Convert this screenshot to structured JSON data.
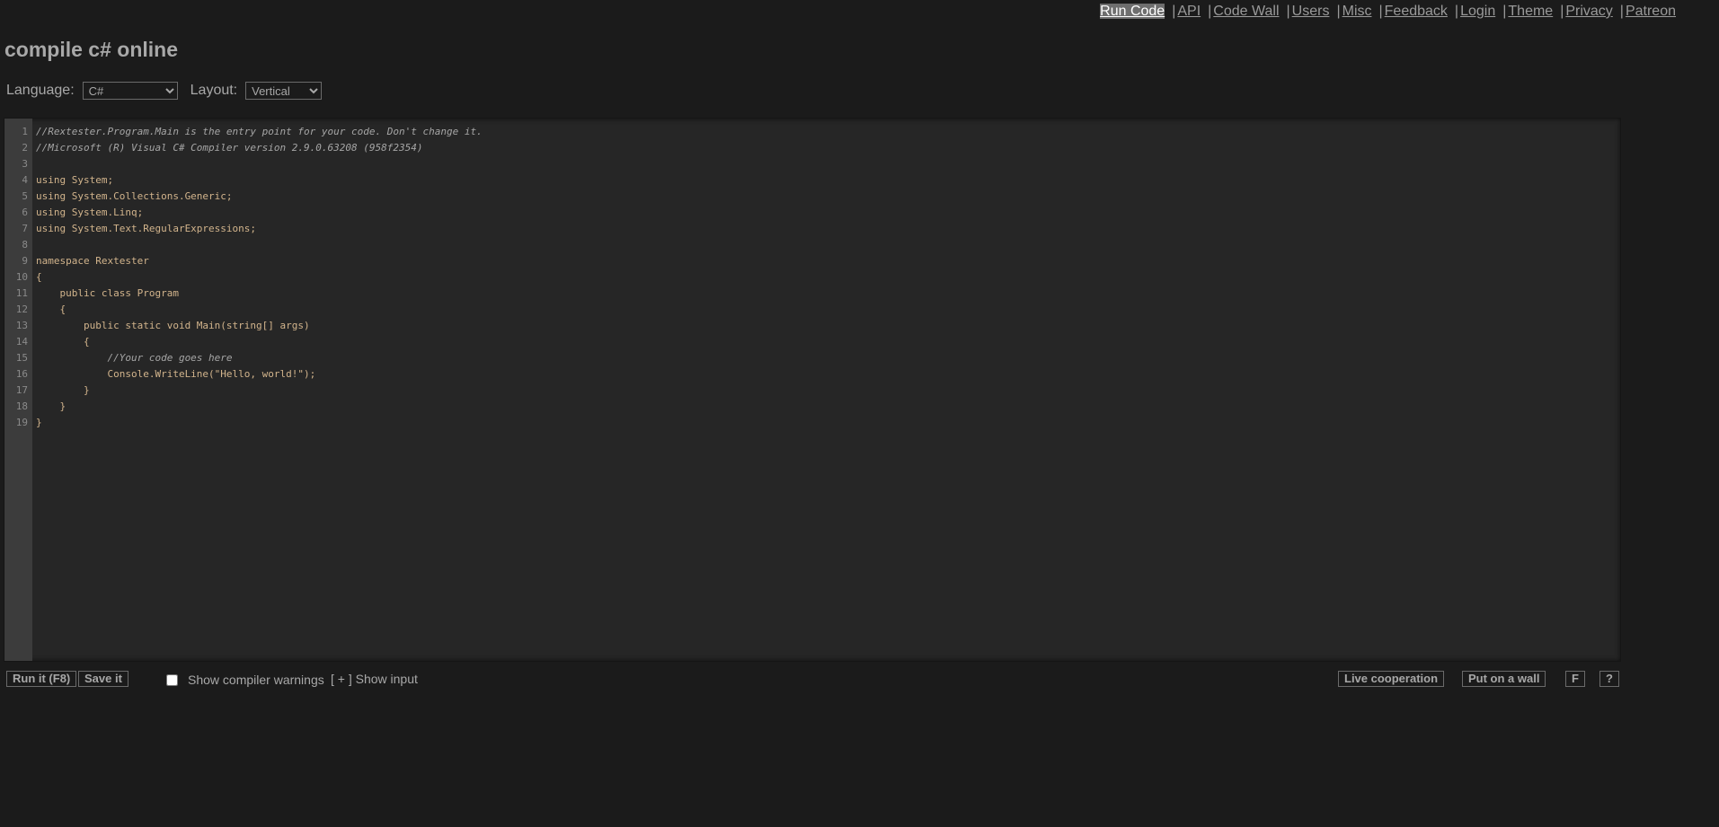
{
  "nav": {
    "items": [
      "Run Code",
      "API",
      "Code Wall",
      "Users",
      "Misc",
      "Feedback",
      "Login",
      "Theme",
      "Privacy",
      "Patreon"
    ],
    "separator": "|"
  },
  "page": {
    "title": "compile c# online"
  },
  "options": {
    "language_label": "Language:",
    "language_value": "C#",
    "layout_label": "Layout:",
    "layout_value": "Vertical"
  },
  "editor": {
    "line_numbers": [
      "1",
      "2",
      "3",
      "4",
      "5",
      "6",
      "7",
      "8",
      "9",
      "10",
      "11",
      "12",
      "13",
      "14",
      "15",
      "16",
      "17",
      "18",
      "19"
    ],
    "lines": [
      "//Rextester.Program.Main is the entry point for your code. Don't change it.",
      "//Microsoft (R) Visual C# Compiler version 2.9.0.63208 (958f2354)",
      "",
      "using System;",
      "using System.Collections.Generic;",
      "using System.Linq;",
      "using System.Text.RegularExpressions;",
      "",
      "namespace Rextester",
      "{",
      "    public class Program",
      "    {",
      "        public static void Main(string[] args)",
      "        {",
      "            //Your code goes here",
      "            Console.WriteLine(\"Hello, world!\");",
      "        }",
      "    }",
      "}"
    ]
  },
  "bottom": {
    "run_label": "Run it (F8)",
    "save_label": "Save it",
    "warnings_label": "Show compiler warnings",
    "show_input_label": "[ + ] Show input",
    "live_coop_label": "Live cooperation",
    "wall_label": "Put on a wall",
    "fullscreen_label": "F",
    "help_label": "?"
  }
}
